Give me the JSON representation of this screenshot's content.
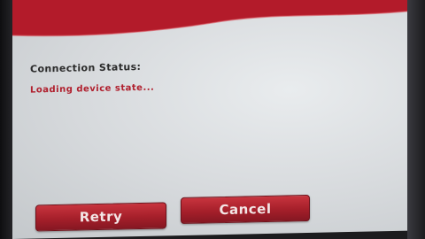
{
  "colors": {
    "header": "#b31b2a",
    "status_value": "#b0202e",
    "button": "#a51f2a"
  },
  "connection": {
    "label": "Connection Status:",
    "value": "Loading device state..."
  },
  "buttons": {
    "retry_label": "Retry",
    "cancel_label": "Cancel"
  }
}
